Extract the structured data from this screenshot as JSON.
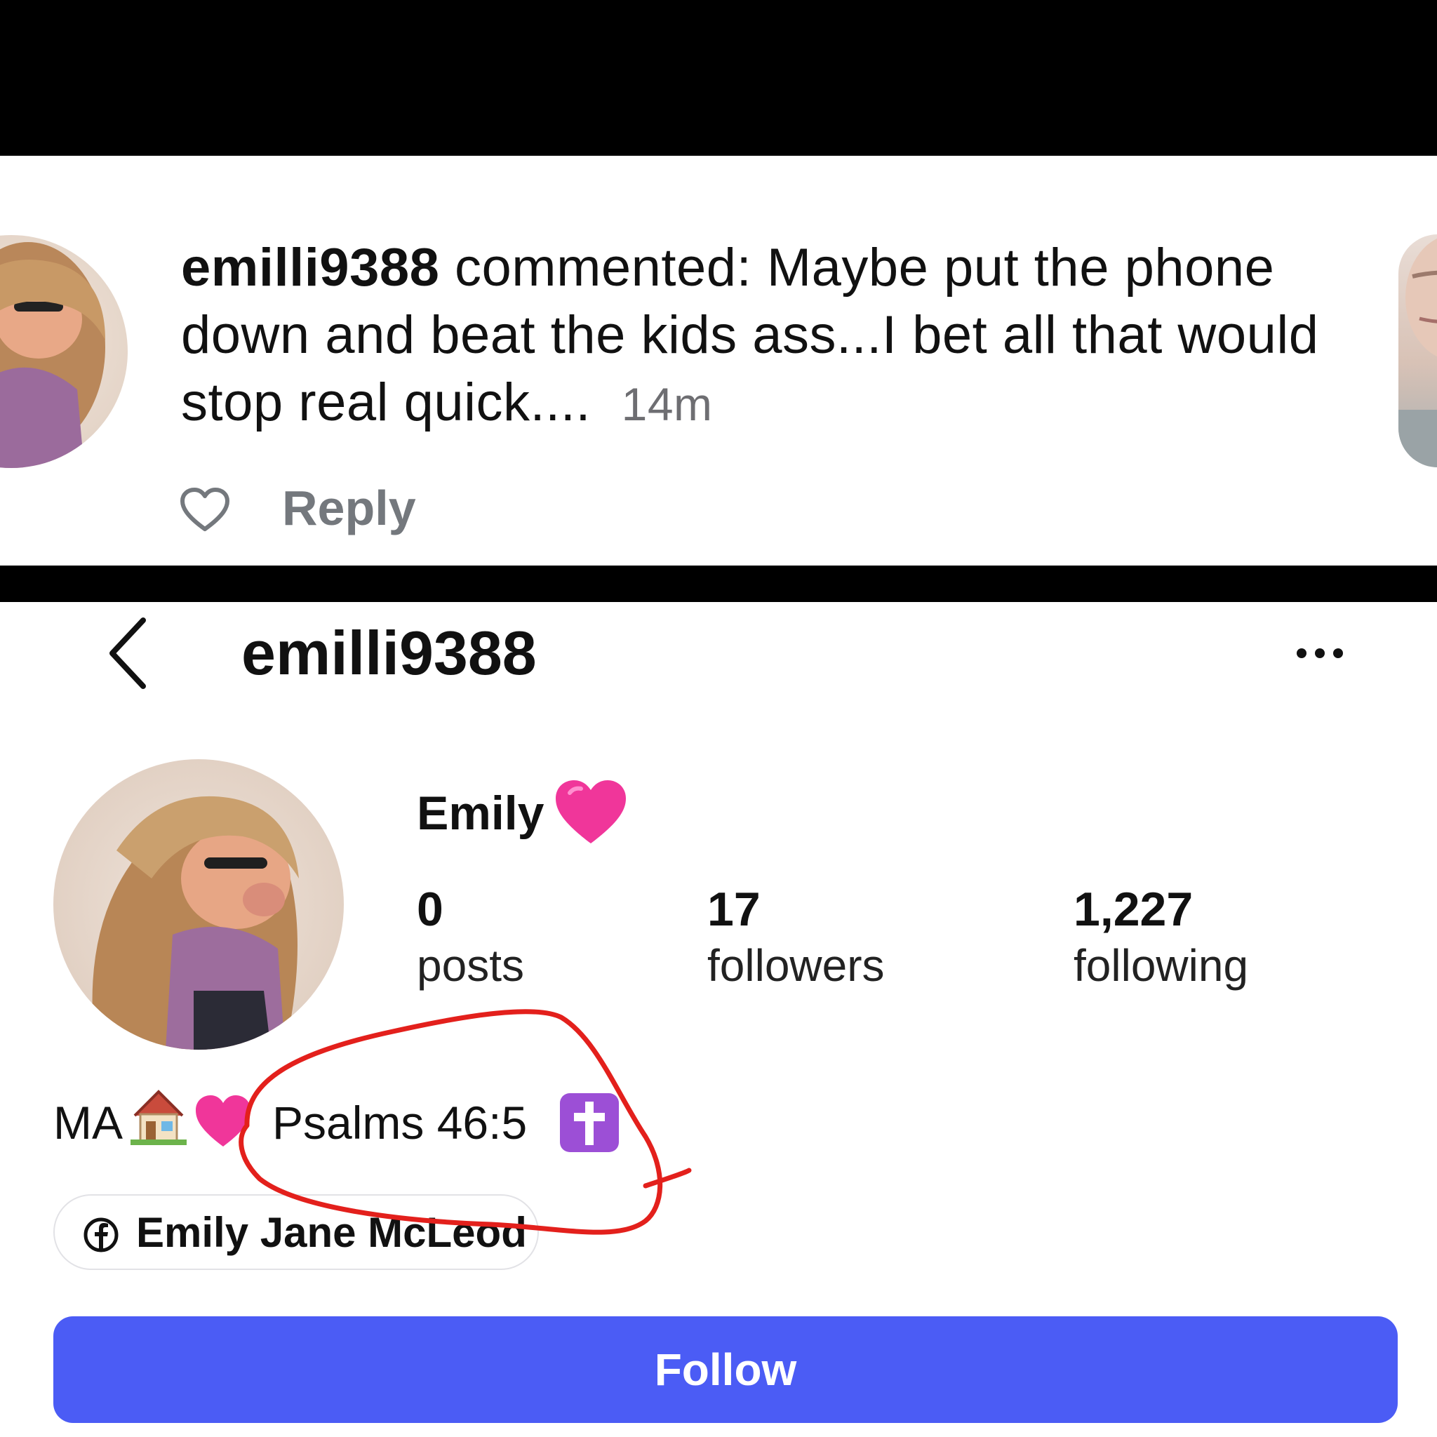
{
  "comment": {
    "username": "emilli9388",
    "action": "commented:",
    "text": "Maybe put the phone down and beat the kids ass...I bet all that would stop real quick....",
    "time": "14m",
    "reply_label": "Reply",
    "icons": {
      "like": "heart-outline-icon"
    }
  },
  "profile": {
    "header_username": "emilli9388",
    "display_name": "Emily",
    "display_name_emoji": "pink-heart-emoji",
    "stats": [
      {
        "value": "0",
        "label": "posts"
      },
      {
        "value": "17",
        "label": "followers"
      },
      {
        "value": "1,227",
        "label": "following"
      }
    ],
    "bio": {
      "location": "MA",
      "verse": "Psalms 46:5",
      "emojis": [
        "house-emoji",
        "pink-heart-emoji",
        "latin-cross-emoji"
      ]
    },
    "facebook_link": "Emily Jane McLeod",
    "follow_label": "Follow",
    "icons": {
      "back": "chevron-left-icon",
      "more": "more-horizontal-icon",
      "facebook": "facebook-icon"
    }
  },
  "colors": {
    "follow_button": "#4b5cf5",
    "annotation": "#e3201c",
    "secondary_text": "#6e6e72",
    "heart_pink": "#f0369a"
  }
}
